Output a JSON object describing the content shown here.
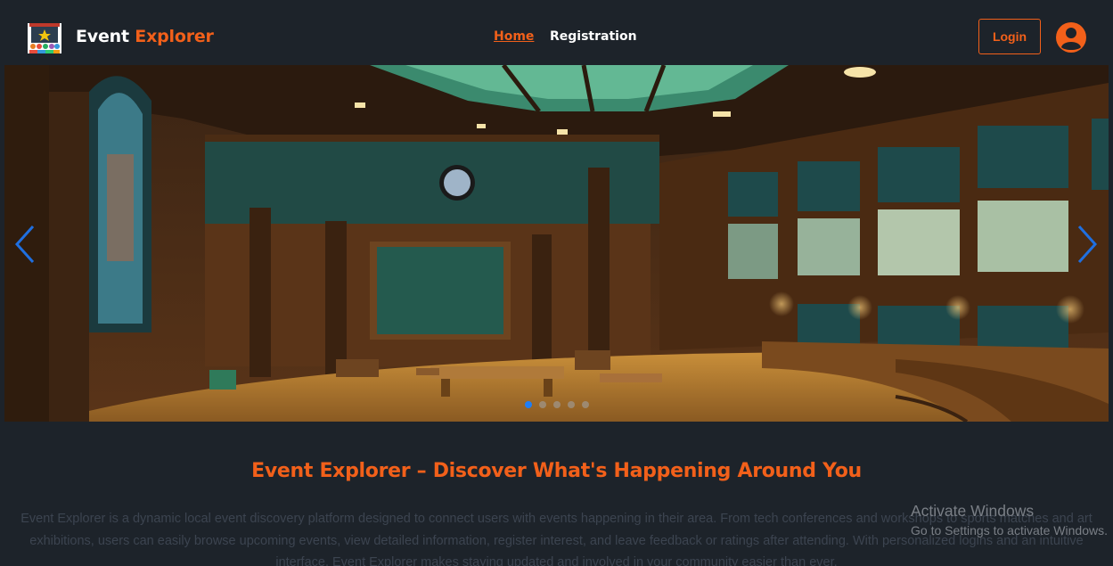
{
  "brand": {
    "name_part1": "Event",
    "name_part2": "Explorer",
    "logo_icon": "event-stage-logo"
  },
  "nav": {
    "links": [
      {
        "label": "Home",
        "active": true
      },
      {
        "label": "Registration",
        "active": false
      }
    ]
  },
  "header": {
    "login_label": "Login",
    "avatar_icon": "user-icon"
  },
  "carousel": {
    "image_subject": "auditorium",
    "slide_count": 5,
    "active_index": 0,
    "prev_icon": "chevron-left-icon",
    "next_icon": "chevron-right-icon"
  },
  "content": {
    "headline": "Event Explorer – Discover What's Happening Around You",
    "description": "Event Explorer is a dynamic local event discovery platform designed to connect users with events happening in their area. From tech conferences and workshops to sports matches and art exhibitions, users can easily browse upcoming events, view detailed information, register interest, and leave feedback or ratings after attending. With personalized logins and an intuitive interface, Event Explorer makes staying updated and involved in your community easier than ever."
  },
  "watermark": {
    "title": "Activate Windows",
    "subtitle": "Go to Settings to activate Windows."
  },
  "colors": {
    "accent": "#f2601a",
    "background": "#1d232a",
    "dot_active": "#1f7ef5",
    "arrow": "#1f6fe0"
  }
}
